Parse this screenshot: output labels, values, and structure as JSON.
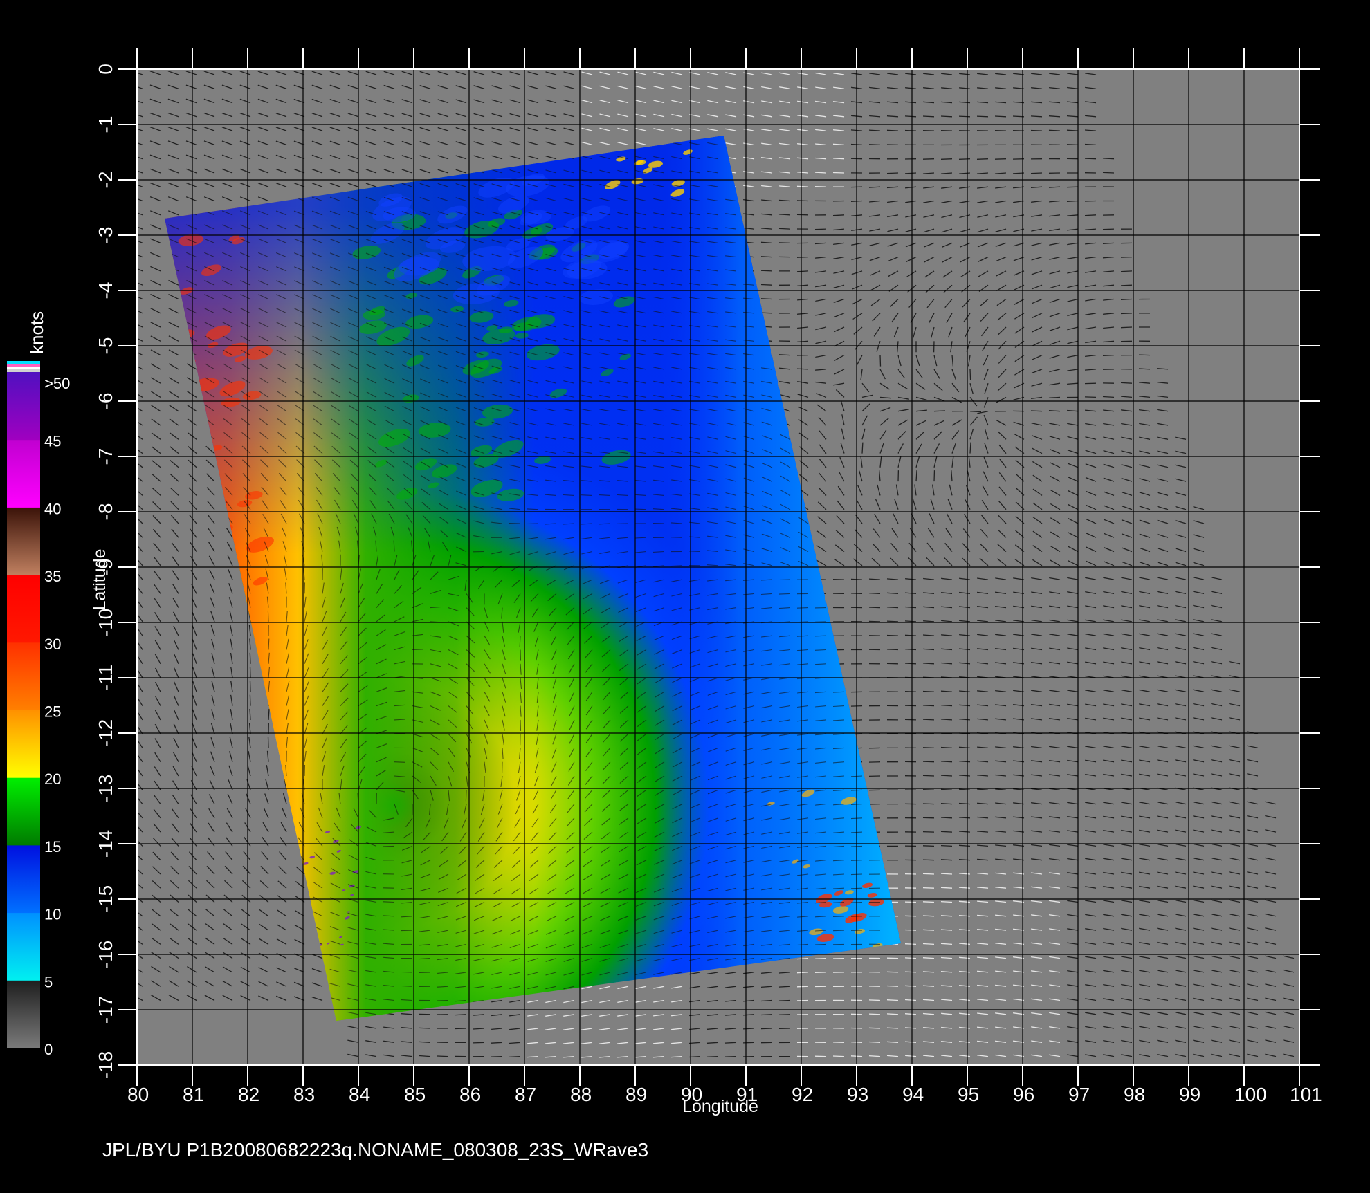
{
  "map": {
    "xlabel": "Longitude",
    "ylabel": "Latitude",
    "caption": "JPL/BYU  P1B20080682223q.NONAME_080308_23S_WRave3",
    "x_range": [
      80,
      101
    ],
    "y_range": [
      -18,
      0
    ],
    "x_ticks": [
      "80",
      "81",
      "82",
      "83",
      "84",
      "85",
      "86",
      "87",
      "88",
      "89",
      "90",
      "91",
      "92",
      "93",
      "94",
      "95",
      "96",
      "97",
      "98",
      "99",
      "100",
      "101"
    ],
    "y_ticks": [
      "0",
      "-1",
      "-2",
      "-3",
      "-4",
      "-5",
      "-6",
      "-7",
      "-8",
      "-9",
      "-10",
      "-11",
      "-12",
      "-13",
      "-14",
      "-15",
      "-16",
      "-17",
      "-18"
    ],
    "background_color": "#808080",
    "grid_color": "#000000"
  },
  "swath": {
    "corners_lonlat": [
      [
        80.5,
        -2.7
      ],
      [
        90.6,
        -1.2
      ],
      [
        93.8,
        -15.8
      ],
      [
        83.6,
        -17.2
      ]
    ]
  },
  "colorbar": {
    "unit": "knots",
    "labels": [
      ">50",
      "45",
      "40",
      "35",
      "30",
      "25",
      "20",
      "15",
      "10",
      "5",
      "0"
    ],
    "segments": [
      {
        "from": 0,
        "to": 5,
        "colors": [
          "#7a7a7a",
          "#1e1e1e"
        ]
      },
      {
        "from": 5,
        "to": 10,
        "colors": [
          "#00f0f0",
          "#0090ff"
        ]
      },
      {
        "from": 10,
        "to": 15,
        "colors": [
          "#0070ff",
          "#0010e0"
        ]
      },
      {
        "from": 15,
        "to": 20,
        "colors": [
          "#007a00",
          "#00f000"
        ]
      },
      {
        "from": 20,
        "to": 25,
        "colors": [
          "#ffff00",
          "#ff9000"
        ]
      },
      {
        "from": 25,
        "to": 30,
        "colors": [
          "#ff8000",
          "#ff3000"
        ]
      },
      {
        "from": 30,
        "to": 35,
        "colors": [
          "#ff1800",
          "#ff0000"
        ]
      },
      {
        "from": 35,
        "to": 40,
        "colors": [
          "#c08060",
          "#3a1208"
        ]
      },
      {
        "from": 40,
        "to": 45,
        "colors": [
          "#ff00ff",
          "#c000d0"
        ]
      },
      {
        "from": 45,
        "to": 50,
        "colors": [
          "#a000c0",
          "#5010c0"
        ]
      }
    ],
    "top_band_colors": [
      "#00e0ff",
      "#ff60c0",
      "#ffffff",
      "#d0d0d0"
    ]
  }
}
